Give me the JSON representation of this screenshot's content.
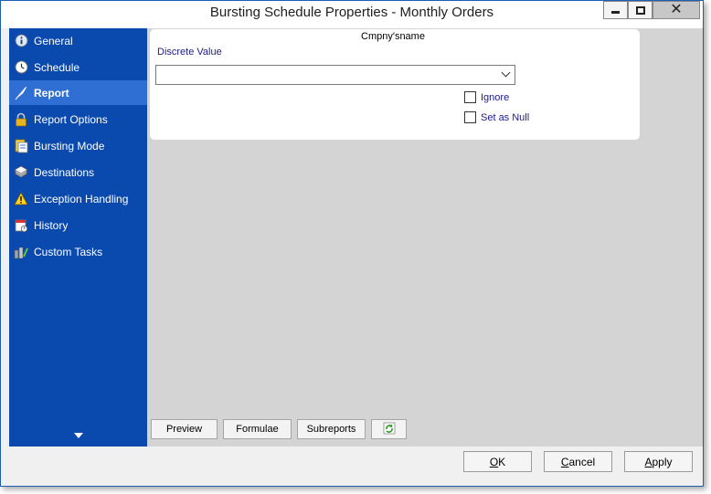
{
  "window": {
    "title": "Bursting Schedule Properties - Monthly Orders"
  },
  "sidebar": {
    "items": [
      {
        "label": "General",
        "icon": "info-icon"
      },
      {
        "label": "Schedule",
        "icon": "clock-icon"
      },
      {
        "label": "Report",
        "icon": "report-quill-icon",
        "active": true
      },
      {
        "label": "Report Options",
        "icon": "padlock-icon"
      },
      {
        "label": "Bursting Mode",
        "icon": "bursting-document-icon"
      },
      {
        "label": "Destinations",
        "icon": "destinations-stack-icon"
      },
      {
        "label": "Exception Handling",
        "icon": "warning-icon"
      },
      {
        "label": "History",
        "icon": "history-calendar-icon"
      },
      {
        "label": "Custom Tasks",
        "icon": "custom-tasks-icon"
      }
    ]
  },
  "parameter": {
    "group_title": "Cmpny'sname",
    "field_label": "Discrete Value",
    "value": "",
    "ignore_label": "Ignore",
    "null_label": "Set as Null"
  },
  "toolbar": {
    "preview_label": "Preview",
    "formulae_label": "Formulae",
    "subreports_label": "Subreports",
    "refresh_icon": "refresh-icon"
  },
  "footer": {
    "ok_label": "OK",
    "cancel_label": "Cancel",
    "apply_label": "Apply"
  },
  "colors": {
    "sidebar": "#0a49ad",
    "sidebar_active": "#2f6fd3",
    "content_bg": "#d4d4d4",
    "label_text": "#1b1b8a"
  }
}
